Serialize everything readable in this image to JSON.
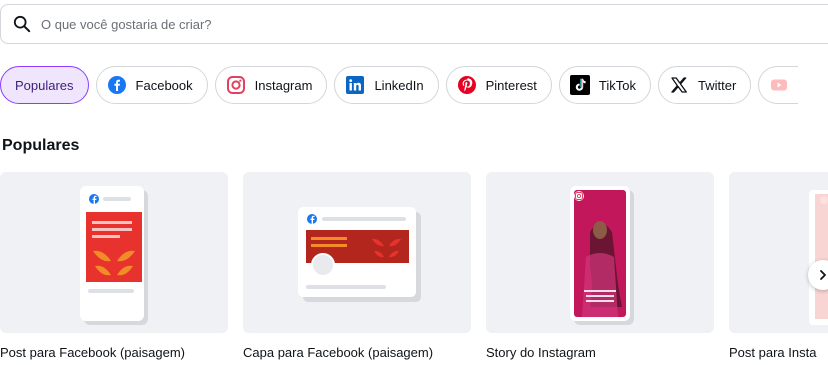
{
  "search": {
    "placeholder": "O que você gostaria de criar?",
    "icon": "search-icon"
  },
  "chips": [
    {
      "label": "Populares",
      "active": true
    },
    {
      "label": "Facebook",
      "icon": "facebook-icon"
    },
    {
      "label": "Instagram",
      "icon": "instagram-icon"
    },
    {
      "label": "LinkedIn",
      "icon": "linkedin-icon"
    },
    {
      "label": "Pinterest",
      "icon": "pinterest-icon"
    },
    {
      "label": "TikTok",
      "icon": "tiktok-icon"
    },
    {
      "label": "Twitter",
      "icon": "x-icon"
    },
    {
      "label": "",
      "icon": "youtube-icon"
    }
  ],
  "section": {
    "title": "Populares"
  },
  "cards": [
    {
      "label": "Post para Facebook (paisagem)"
    },
    {
      "label": "Capa para Facebook (paisagem)"
    },
    {
      "label": "Story do Instagram"
    },
    {
      "label": "Post para Insta"
    }
  ],
  "colors": {
    "accent": "#8b3dff",
    "facebook": "#1877f2",
    "brand_red": "#e8322e",
    "accent_orange": "#f28c28"
  }
}
